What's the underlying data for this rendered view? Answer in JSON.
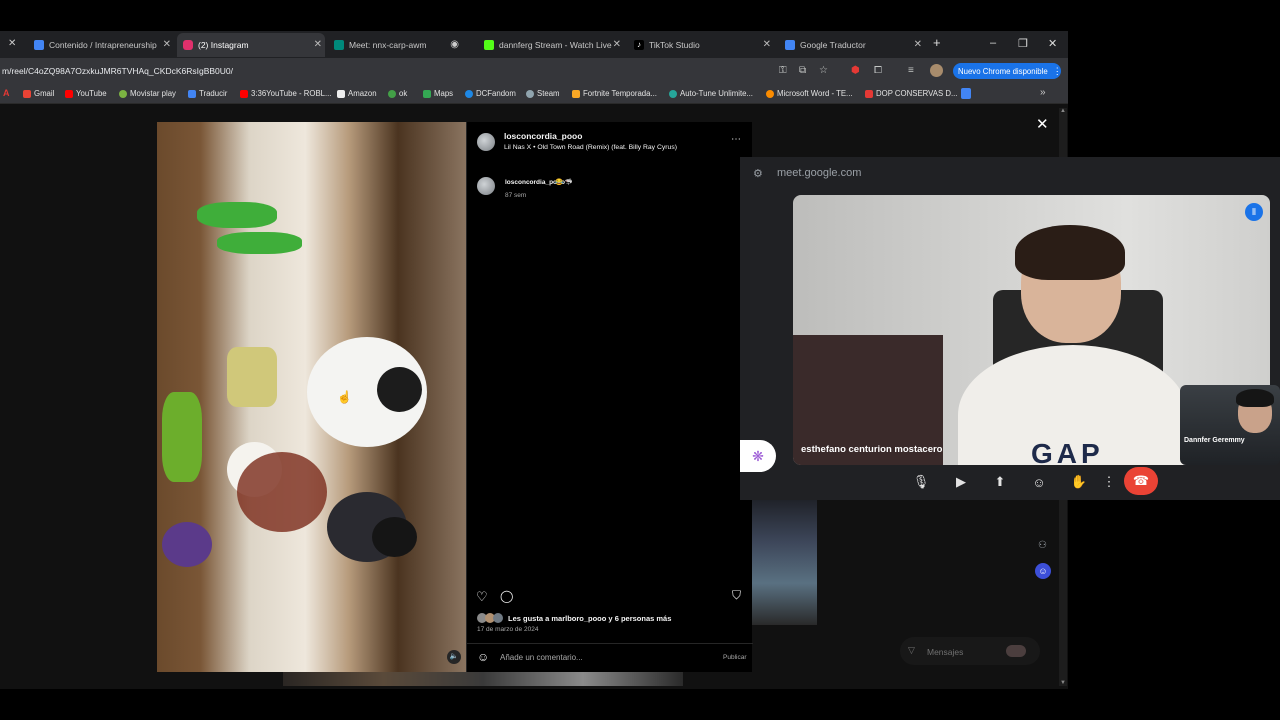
{
  "tabs": [
    {
      "label": "Contenido / Intrapreneurship",
      "color": "#4285f4"
    },
    {
      "label": "(2) Instagram",
      "color": "#e1306c"
    },
    {
      "label": "Meet: nnx-carp-awm",
      "color": "#00897b"
    },
    {
      "label": "dannferg Stream - Watch Live",
      "color": "#53fc18"
    },
    {
      "label": "TikTok Studio",
      "color": "#ffffff"
    },
    {
      "label": "Google Traductor",
      "color": "#4285f4"
    }
  ],
  "address": {
    "url": "m/reel/C4oZQ98A7OzxkuJMR6TVHAq_CKDcK6RsIgBB0U0/"
  },
  "update_button": "Nuevo Chrome disponible",
  "bookmarks": [
    {
      "label": "Gmail",
      "color": "#ea4335"
    },
    {
      "label": "YouTube",
      "color": "#ff0000"
    },
    {
      "label": "Movistar play",
      "color": "#7cb342"
    },
    {
      "label": "Traducir",
      "color": "#4285f4"
    },
    {
      "label": "3:36YouTube - ROBL...",
      "color": "#ff0000"
    },
    {
      "label": "Amazon",
      "color": "#eeeeee"
    },
    {
      "label": "ok",
      "color": "#43a047"
    },
    {
      "label": "Maps",
      "color": "#34a853"
    },
    {
      "label": "DCFandom",
      "color": "#1e88e5"
    },
    {
      "label": "Steam",
      "color": "#90a4ae"
    },
    {
      "label": "Fortnite Temporada...",
      "color": "#f9a825"
    },
    {
      "label": "Auto-Tune Unlimite...",
      "color": "#26a69a"
    },
    {
      "label": "Microsoft Word - TE...",
      "color": "#fb8c00"
    },
    {
      "label": "DOP CONSERVAS D...",
      "color": "#e53935"
    }
  ],
  "instagram": {
    "username": "losconcordia_pooo",
    "audio": "Lil Nas X • Old Town Road (Remix) (feat. Billy Ray Cyrus)",
    "comment_user": "losconcordia_pooo",
    "comment_emoji": "😂 🦈",
    "comment_time": "87 sem",
    "likes": "Les gusta a marlboro_pooo y 6 personas más",
    "date": "17 de marzo de 2024",
    "comment_placeholder": "Añade un comentario...",
    "publish": "Publicar"
  },
  "meet": {
    "domain": "meet.google.com",
    "participant_main": "esthefano centurion mostacero",
    "participant_self": "Dannfer Geremmy",
    "messages": "Mensajes"
  }
}
